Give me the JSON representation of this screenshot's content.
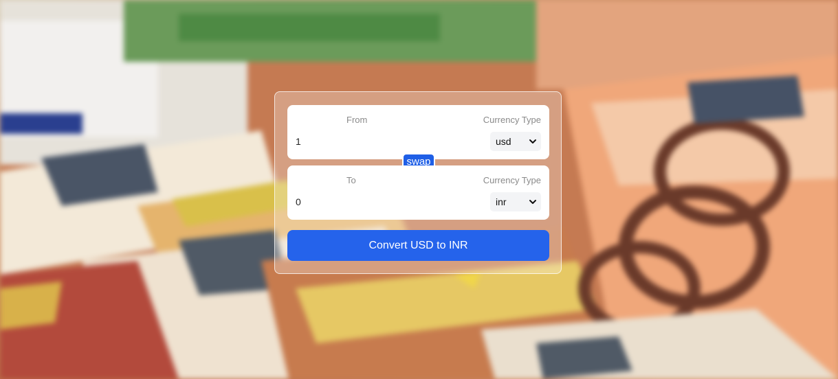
{
  "converter": {
    "from": {
      "label": "From",
      "currency_label": "Currency Type",
      "amount": "1",
      "currency": "usd"
    },
    "to": {
      "label": "To",
      "currency_label": "Currency Type",
      "amount": "0",
      "currency": "inr"
    },
    "swap_label": "swap",
    "convert_label": "Convert USD to INR"
  },
  "colors": {
    "button": "#2563eb",
    "swap": "#1f5fe6"
  },
  "icons": {
    "dropdown": "chevron-down-icon"
  }
}
